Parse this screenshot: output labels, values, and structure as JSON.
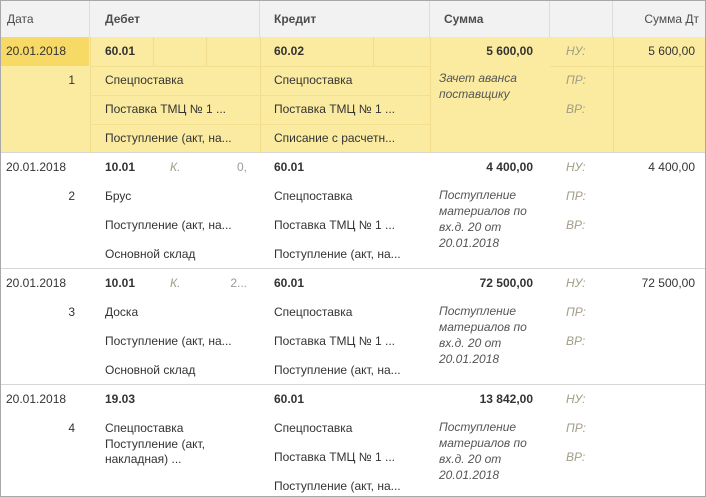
{
  "columns": {
    "date": "Дата",
    "debet": "Дебет",
    "kredit": "Кредит",
    "summa": "Сумма",
    "summa_dt": "Сумма Дт"
  },
  "rows": [
    {
      "date": "20.01.2018",
      "number": "1",
      "debit_account": "60.01",
      "debit_flag": "",
      "debit_qty": "",
      "debit_subconto": [
        "Спецпоставка",
        "Поставка ТМЦ № 1 ...",
        "Поступление (акт, на..."
      ],
      "credit_account": "60.02",
      "credit_subconto": [
        "Спецпоставка",
        "Поставка ТМЦ № 1 ...",
        "Списание с расчетн..."
      ],
      "amount": "5 600,00",
      "description": "Зачет аванса поставщику",
      "tax_labels": [
        "НУ:",
        "ПР:",
        "ВР:"
      ],
      "amount_dt": "5 600,00",
      "selected": true
    },
    {
      "date": "20.01.2018",
      "number": "2",
      "debit_account": "10.01",
      "debit_flag": "К.",
      "debit_qty": "0,",
      "debit_subconto": [
        "Брус",
        "Поступление (акт, на...",
        "Основной склад"
      ],
      "credit_account": "60.01",
      "credit_subconto": [
        "Спецпоставка",
        "Поставка ТМЦ № 1 ...",
        "Поступление (акт, на..."
      ],
      "amount": "4 400,00",
      "description": "Поступление материалов по вх.д. 20 от 20.01.2018",
      "tax_labels": [
        "НУ:",
        "ПР:",
        "ВР:"
      ],
      "amount_dt": "4 400,00",
      "selected": false
    },
    {
      "date": "20.01.2018",
      "number": "3",
      "debit_account": "10.01",
      "debit_flag": "К.",
      "debit_qty": "2...",
      "debit_subconto": [
        "Доска",
        "Поступление (акт, на...",
        "Основной склад"
      ],
      "credit_account": "60.01",
      "credit_subconto": [
        "Спецпоставка",
        "Поставка ТМЦ № 1 ...",
        "Поступление (акт, на..."
      ],
      "amount": "72 500,00",
      "description": "Поступление материалов по вх.д. 20 от 20.01.2018",
      "tax_labels": [
        "НУ:",
        "ПР:",
        "ВР:"
      ],
      "amount_dt": "72 500,00",
      "selected": false
    },
    {
      "date": "20.01.2018",
      "number": "4",
      "debit_account": "19.03",
      "debit_flag": "",
      "debit_qty": "",
      "debit_subconto": [
        "Спецпоставка",
        "Поступление (акт, накладная) ...",
        ""
      ],
      "credit_account": "60.01",
      "credit_subconto": [
        "Спецпоставка",
        "Поставка ТМЦ № 1 ...",
        "Поступление (акт, на..."
      ],
      "amount": "13 842,00",
      "description": "Поступление материалов по вх.д. 20 от 20.01.2018",
      "tax_labels": [
        "НУ:",
        "ПР:",
        "ВР:"
      ],
      "amount_dt": "",
      "selected": false
    }
  ],
  "colors": {
    "selected_row": "#fbeba0",
    "selected_date": "#f7d966",
    "header_bg": "#f2f2f2"
  }
}
